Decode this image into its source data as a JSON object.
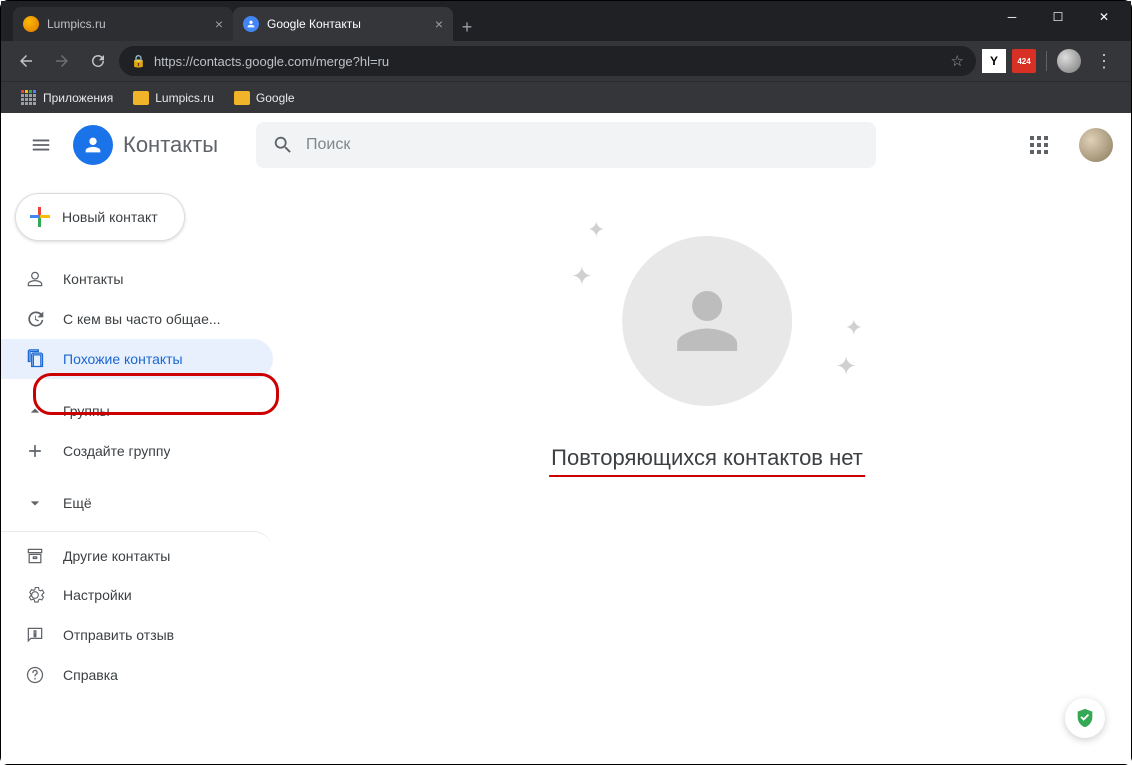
{
  "browser": {
    "tabs": [
      {
        "title": "Lumpics.ru",
        "active": false
      },
      {
        "title": "Google Контакты",
        "active": true
      }
    ],
    "url": "https://contacts.google.com/merge?hl=ru",
    "bookmarks": [
      {
        "label": "Приложения",
        "type": "apps"
      },
      {
        "label": "Lumpics.ru",
        "type": "folder"
      },
      {
        "label": "Google",
        "type": "folder"
      }
    ],
    "gmail_badge": "424"
  },
  "app": {
    "title": "Контакты",
    "search_placeholder": "Поиск",
    "new_contact_label": "Новый контакт"
  },
  "sidebar": {
    "items": [
      {
        "label": "Контакты"
      },
      {
        "label": "С кем вы часто общае..."
      },
      {
        "label": "Похожие контакты"
      },
      {
        "label": "Группы"
      },
      {
        "label": "Создайте группу"
      },
      {
        "label": "Ещё"
      },
      {
        "label": "Другие контакты"
      },
      {
        "label": "Настройки"
      },
      {
        "label": "Отправить отзыв"
      },
      {
        "label": "Справка"
      }
    ]
  },
  "main": {
    "empty_message": "Повторяющихся контактов нет"
  }
}
